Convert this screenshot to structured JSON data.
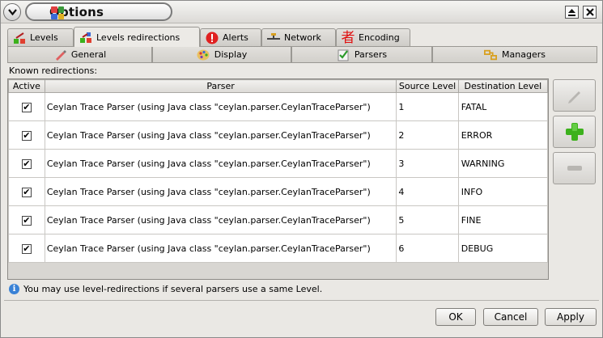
{
  "window": {
    "title": "Options"
  },
  "tabs_primary": [
    {
      "label": "Levels",
      "icon": "levels-icon",
      "active": false
    },
    {
      "label": "Levels redirections",
      "icon": "levels-redirections-icon",
      "active": true
    },
    {
      "label": "Alerts",
      "icon": "alert-icon",
      "active": false
    },
    {
      "label": "Network",
      "icon": "network-icon",
      "active": false
    },
    {
      "label": "Encoding",
      "icon": "encoding-icon",
      "glyph": "者",
      "active": false
    }
  ],
  "tabs_secondary": [
    {
      "label": "General",
      "icon": "pencil-icon"
    },
    {
      "label": "Display",
      "icon": "palette-icon"
    },
    {
      "label": "Parsers",
      "icon": "checklist-icon"
    },
    {
      "label": "Managers",
      "icon": "managers-icon"
    }
  ],
  "panel": {
    "known_label": "Known redirections:",
    "columns": [
      "Active",
      "Parser",
      "Source Level",
      "Destination Level"
    ],
    "rows": [
      {
        "active": true,
        "parser": "Ceylan Trace Parser (using Java class \"ceylan.parser.CeylanTraceParser\")",
        "source": "1",
        "destination": "FATAL"
      },
      {
        "active": true,
        "parser": "Ceylan Trace Parser (using Java class \"ceylan.parser.CeylanTraceParser\")",
        "source": "2",
        "destination": "ERROR"
      },
      {
        "active": true,
        "parser": "Ceylan Trace Parser (using Java class \"ceylan.parser.CeylanTraceParser\")",
        "source": "3",
        "destination": "WARNING"
      },
      {
        "active": true,
        "parser": "Ceylan Trace Parser (using Java class \"ceylan.parser.CeylanTraceParser\")",
        "source": "4",
        "destination": "INFO"
      },
      {
        "active": true,
        "parser": "Ceylan Trace Parser (using Java class \"ceylan.parser.CeylanTraceParser\")",
        "source": "5",
        "destination": "FINE"
      },
      {
        "active": true,
        "parser": "Ceylan Trace Parser (using Java class \"ceylan.parser.CeylanTraceParser\")",
        "source": "6",
        "destination": "DEBUG"
      }
    ],
    "check_glyph": "✔",
    "side_buttons": [
      {
        "name": "edit-button",
        "icon": "pencil-icon",
        "enabled": false
      },
      {
        "name": "add-button",
        "icon": "plus-icon",
        "enabled": true
      },
      {
        "name": "remove-button",
        "icon": "minus-icon",
        "enabled": false
      }
    ],
    "info_text": "You may use level-redirections if several parsers use a same Level."
  },
  "buttons": {
    "ok": "OK",
    "cancel": "Cancel",
    "apply": "Apply"
  },
  "colors": {
    "accent_green": "#3cb11c",
    "alert_red": "#e02020",
    "info_blue": "#3a82d6",
    "encoding_red": "#e01010"
  }
}
